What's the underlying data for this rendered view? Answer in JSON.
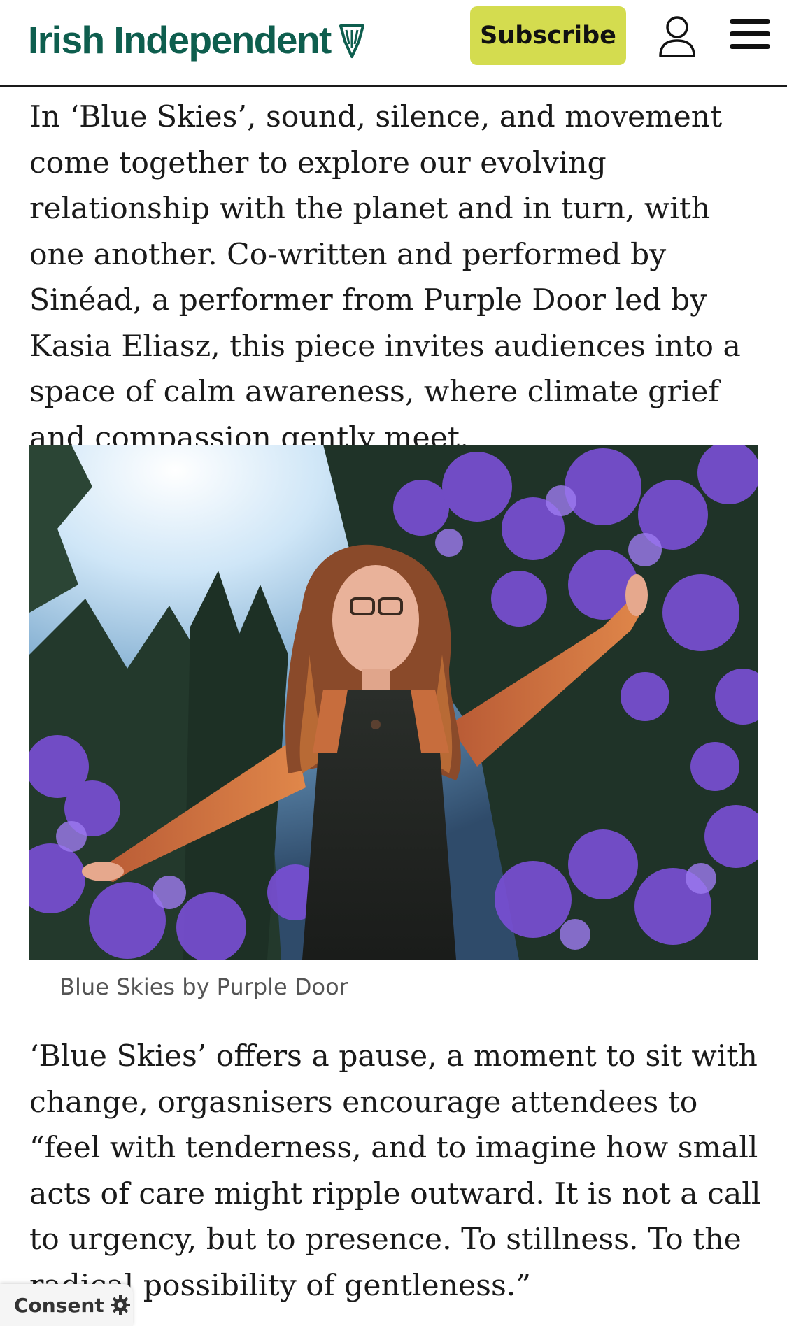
{
  "header": {
    "logo_text": "Irish Independent",
    "logo_icon": "harp-icon",
    "subscribe_label": "Subscribe",
    "account_icon": "account-icon",
    "menu_icon": "menu-icon",
    "brand_color": "#0e5e4e",
    "subscribe_color": "#d4dc4f"
  },
  "article": {
    "paragraph_1": "In ‘Blue Skies’, sound, silence, and movement come together to explore our evolving relationship with the planet and in turn, with one another. Co-written and performed by Sinéad, a performer from Purple Door led by Kasia Eliasz, this piece invites audiences into a space of calm awareness, where climate grief and compassion gently meet.",
    "image_caption": "Blue Skies by Purple Door",
    "paragraph_2": "‘Blue Skies’ offers a pause, a moment to sit with change, orgasnisers encourage attendees to “feel with tenderness, and to imagine how small acts of care might ripple outward. It is not a call to urgency, but to presence. To stillness. To the radical possibility of gentleness.”"
  },
  "consent": {
    "label": "Consent",
    "icon": "gear-icon"
  }
}
